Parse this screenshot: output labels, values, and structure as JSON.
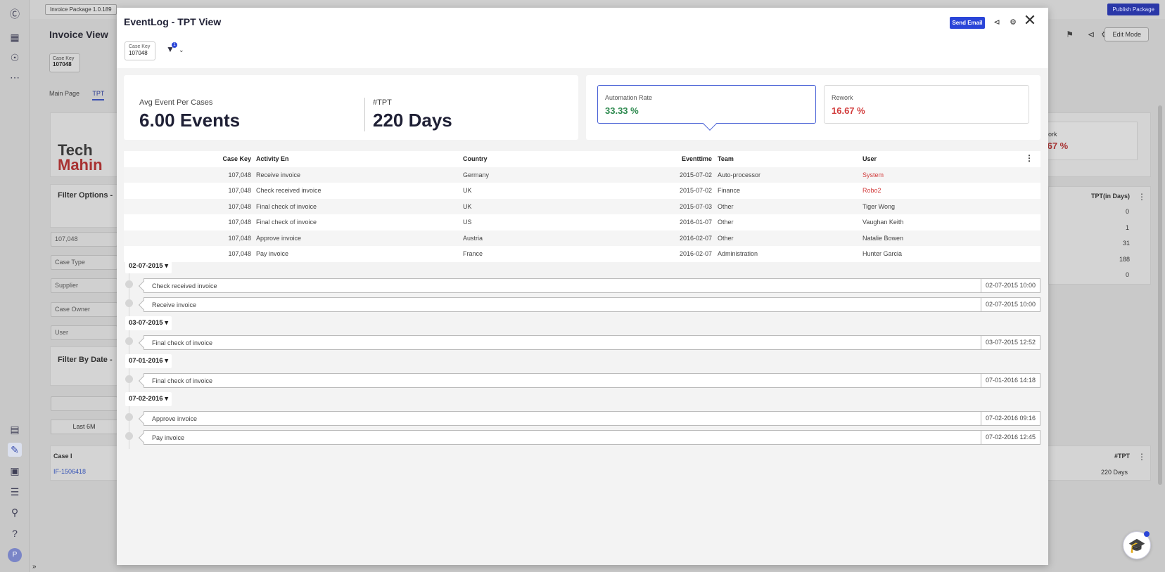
{
  "background": {
    "package_select": "Invoice Package 1.0.189",
    "publish_button": "Publish Package",
    "page_title": "Invoice View",
    "case_key_label": "Case Key",
    "case_key_value": "107048",
    "tabs": [
      "Main Page",
      "TPT"
    ],
    "edit_mode": "Edit Mode",
    "logo_line1": "Tech",
    "logo_line2": "Mahin",
    "filter_options": "Filter Options -",
    "inputs": [
      "107,048",
      "Case Type",
      "Supplier",
      "Case Owner",
      "User"
    ],
    "filter_by_date": "Filter By Date -",
    "last_button": "Last 6M",
    "rework_value": ".67 %",
    "rework_label": "ork",
    "tpt_header": "TPT(in Days)",
    "tpt_values": [
      "0",
      "1",
      "31",
      "188",
      "0"
    ],
    "case_col": "Case I",
    "case_link": "IF-1506418",
    "tpt_col2": "#TPT",
    "tpt_days": "220 Days",
    "avatar": "P"
  },
  "modal": {
    "title": "EventLog - TPT View",
    "send_email": "Send Email",
    "case_key_label": "Case Key",
    "case_key_value": "107048",
    "filter_count": "1",
    "kpis": {
      "avg_label": "Avg Event Per Cases",
      "avg_value": "6.00 Events",
      "tpt_label": "#TPT",
      "tpt_value": "220 Days",
      "automation_label": "Automation Rate",
      "automation_value": "33.33 %",
      "rework_label": "Rework",
      "rework_value": "16.67 %"
    },
    "table": {
      "headers": [
        "Case Key",
        "Activity En",
        "Country",
        "Eventtime",
        "Team",
        "User"
      ],
      "rows": [
        [
          "107,048",
          "Receive invoice",
          "Germany",
          "2015-07-02",
          "Auto-processor",
          "System"
        ],
        [
          "107,048",
          "Check received invoice",
          "UK",
          "2015-07-02",
          "Finance",
          "Robo2"
        ],
        [
          "107,048",
          "Final check of invoice",
          "UK",
          "2015-07-03",
          "Other",
          "Tiger Wong"
        ],
        [
          "107,048",
          "Final check of invoice",
          "US",
          "2016-01-07",
          "Other",
          "Vaughan Keith"
        ],
        [
          "107,048",
          "Approve invoice",
          "Austria",
          "2016-02-07",
          "Other",
          "Natalie Bowen"
        ],
        [
          "107,048",
          "Pay invoice",
          "France",
          "2016-02-07",
          "Administration",
          "Hunter Garcia"
        ]
      ]
    },
    "timeline": {
      "groups": [
        {
          "date": "02-07-2015",
          "items": [
            {
              "activity": "Check received invoice",
              "time": "02-07-2015 10:00"
            },
            {
              "activity": "Receive invoice",
              "time": "02-07-2015 10:00"
            }
          ]
        },
        {
          "date": "03-07-2015",
          "items": [
            {
              "activity": "Final check of invoice",
              "time": "03-07-2015 12:52"
            }
          ]
        },
        {
          "date": "07-01-2016",
          "items": [
            {
              "activity": "Final check of invoice",
              "time": "07-01-2016 14:18"
            }
          ]
        },
        {
          "date": "07-02-2016",
          "items": [
            {
              "activity": "Approve invoice",
              "time": "07-02-2016 09:16"
            },
            {
              "activity": "Pay invoice",
              "time": "07-02-2016 12:45"
            }
          ]
        }
      ]
    }
  },
  "colors": {
    "accent": "#2a45d8",
    "positive": "#2e8a4f",
    "negative": "#d23c3c"
  }
}
